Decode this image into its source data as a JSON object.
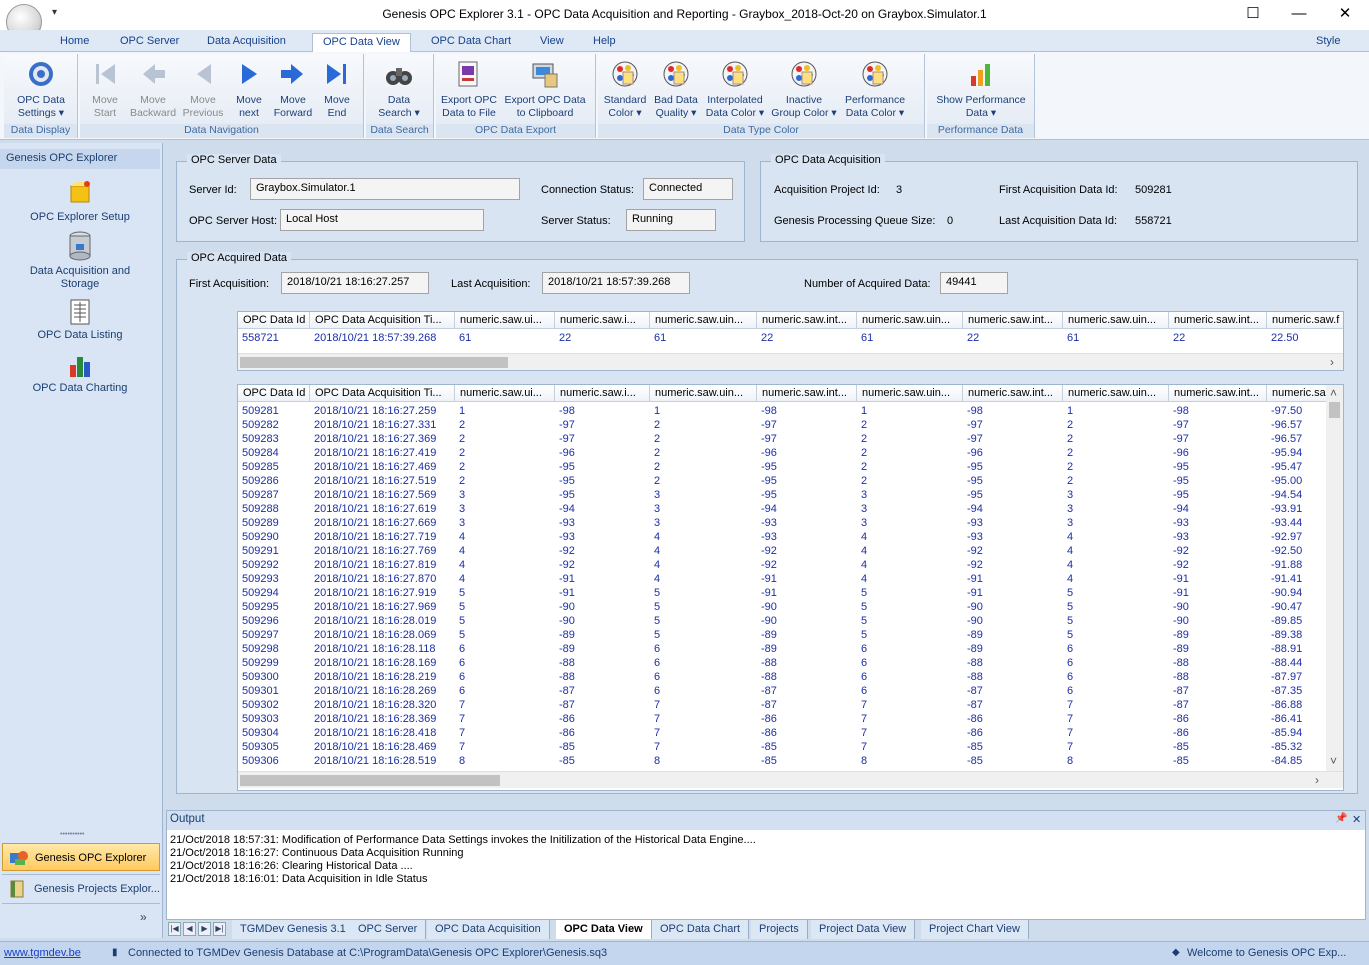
{
  "window": {
    "title": "Genesis OPC Explorer 3.1 - OPC Data Acquisition and Reporting - Graybox_2018-Oct-20 on Graybox.Simulator.1",
    "qat": "▾",
    "minimize": "—",
    "maximize": "☐",
    "close": "✕"
  },
  "menu": {
    "tabs": [
      "Home",
      "OPC Server",
      "Data Acquisition",
      "OPC Data View",
      "OPC Data Chart",
      "View",
      "Help"
    ],
    "active": "OPC Data View",
    "style": "Style"
  },
  "ribbon": {
    "groups": [
      {
        "label": "Data Display",
        "buttons": [
          {
            "l1": "OPC Data",
            "l2": "Settings ▾",
            "icon": "gear-icon"
          }
        ]
      },
      {
        "label": "Data Navigation",
        "buttons": [
          {
            "l1": "Move",
            "l2": "Start",
            "icon": "move-start-icon",
            "enabled": false
          },
          {
            "l1": "Move",
            "l2": "Backward",
            "icon": "move-backward-icon",
            "enabled": false
          },
          {
            "l1": "Move",
            "l2": "Previous",
            "icon": "move-previous-icon",
            "enabled": false
          },
          {
            "l1": "Move",
            "l2": "next",
            "icon": "move-next-icon",
            "enabled": true
          },
          {
            "l1": "Move",
            "l2": "Forward",
            "icon": "move-forward-icon",
            "enabled": true
          },
          {
            "l1": "Move",
            "l2": "End",
            "icon": "move-end-icon",
            "enabled": true
          }
        ]
      },
      {
        "label": "Data Search",
        "buttons": [
          {
            "l1": "Data",
            "l2": "Search ▾",
            "icon": "binoculars-icon"
          }
        ]
      },
      {
        "label": "OPC Data Export",
        "buttons": [
          {
            "l1": "Export OPC",
            "l2": "Data to File",
            "icon": "export-file-icon"
          },
          {
            "l1": "Export OPC Data",
            "l2": "to Clipboard",
            "icon": "export-clipboard-icon"
          }
        ]
      },
      {
        "label": "Data Type Color",
        "buttons": [
          {
            "l1": "Standard",
            "l2": "Color ▾",
            "icon": "palette-icon"
          },
          {
            "l1": "Bad Data",
            "l2": "Quality ▾",
            "icon": "palette-icon"
          },
          {
            "l1": "Interpolated",
            "l2": "Data Color ▾",
            "icon": "palette-icon"
          },
          {
            "l1": "Inactive",
            "l2": "Group Color ▾",
            "icon": "palette-icon"
          },
          {
            "l1": "Performance",
            "l2": "Data Color ▾",
            "icon": "palette-icon"
          }
        ]
      },
      {
        "label": "Performance Data",
        "buttons": [
          {
            "l1": "Show Performance",
            "l2": "Data ▾",
            "icon": "bar-chart-icon"
          }
        ]
      }
    ]
  },
  "leftpane": {
    "header": "Genesis OPC Explorer",
    "items": [
      {
        "label": "OPC Explorer Setup",
        "icon": "setup-icon"
      },
      {
        "label": "Data Acquisition and Storage",
        "icon": "database-icon"
      },
      {
        "label": "OPC Data Listing",
        "icon": "listing-icon"
      },
      {
        "label": "OPC Data Charting",
        "icon": "charting-icon"
      }
    ],
    "grip": "••••••••••",
    "tabs": [
      "Genesis OPC Explorer",
      "Genesis Projects Explor..."
    ],
    "more": "»"
  },
  "server": {
    "title": "OPC Server Data",
    "id_label": "Server Id:",
    "id": "Graybox.Simulator.1",
    "host_label": "OPC Server Host:",
    "host": "Local Host",
    "conn_label": "Connection Status:",
    "conn": "Connected",
    "status_label": "Server Status:",
    "status": "Running"
  },
  "acq": {
    "title": "OPC Data Acquisition",
    "project_label": "Acquisition Project Id:",
    "project": "3",
    "queue_label": "Genesis Processing Queue Size:",
    "queue": "0",
    "first_label": "First Acquisition Data Id:",
    "first": "509281",
    "last_label": "Last Acquisition Data Id:",
    "last": "558721"
  },
  "acquired": {
    "title": "OPC Acquired Data",
    "first_label": "First Acquisition:",
    "first": "2018/10/21 18:16:27.257",
    "last_label": "Last Acquisition:",
    "last": "2018/10/21 18:57:39.268",
    "count_label": "Number of Acquired Data:",
    "count": "49441"
  },
  "grid_columns": [
    "OPC Data Id",
    "OPC Data Acquisition Ti...",
    "numeric.saw.ui...",
    "numeric.saw.i...",
    "numeric.saw.uin...",
    "numeric.saw.int...",
    "numeric.saw.uin...",
    "numeric.saw.int...",
    "numeric.saw.uin...",
    "numeric.saw.int...",
    "numeric.saw.f"
  ],
  "grid_columns2": [
    "OPC Data Id",
    "OPC Data Acquisition Ti...",
    "numeric.saw.ui...",
    "numeric.saw.i...",
    "numeric.saw.uin...",
    "numeric.saw.int...",
    "numeric.saw.uin...",
    "numeric.saw.int...",
    "numeric.saw.uin...",
    "numeric.saw.int...",
    "numeric.sa"
  ],
  "latest_row": [
    "558721",
    "2018/10/21 18:57:39.268",
    "61",
    "22",
    "61",
    "22",
    "61",
    "22",
    "61",
    "22",
    "22.50"
  ],
  "rows": [
    [
      "509281",
      "2018/10/21 18:16:27.259",
      "1",
      "-98",
      "1",
      "-98",
      "1",
      "-98",
      "1",
      "-98",
      "-97.50"
    ],
    [
      "509282",
      "2018/10/21 18:16:27.331",
      "2",
      "-97",
      "2",
      "-97",
      "2",
      "-97",
      "2",
      "-97",
      "-96.57"
    ],
    [
      "509283",
      "2018/10/21 18:16:27.369",
      "2",
      "-97",
      "2",
      "-97",
      "2",
      "-97",
      "2",
      "-97",
      "-96.57"
    ],
    [
      "509284",
      "2018/10/21 18:16:27.419",
      "2",
      "-96",
      "2",
      "-96",
      "2",
      "-96",
      "2",
      "-96",
      "-95.94"
    ],
    [
      "509285",
      "2018/10/21 18:16:27.469",
      "2",
      "-95",
      "2",
      "-95",
      "2",
      "-95",
      "2",
      "-95",
      "-95.47"
    ],
    [
      "509286",
      "2018/10/21 18:16:27.519",
      "2",
      "-95",
      "2",
      "-95",
      "2",
      "-95",
      "2",
      "-95",
      "-95.00"
    ],
    [
      "509287",
      "2018/10/21 18:16:27.569",
      "3",
      "-95",
      "3",
      "-95",
      "3",
      "-95",
      "3",
      "-95",
      "-94.54"
    ],
    [
      "509288",
      "2018/10/21 18:16:27.619",
      "3",
      "-94",
      "3",
      "-94",
      "3",
      "-94",
      "3",
      "-94",
      "-93.91"
    ],
    [
      "509289",
      "2018/10/21 18:16:27.669",
      "3",
      "-93",
      "3",
      "-93",
      "3",
      "-93",
      "3",
      "-93",
      "-93.44"
    ],
    [
      "509290",
      "2018/10/21 18:16:27.719",
      "4",
      "-93",
      "4",
      "-93",
      "4",
      "-93",
      "4",
      "-93",
      "-92.97"
    ],
    [
      "509291",
      "2018/10/21 18:16:27.769",
      "4",
      "-92",
      "4",
      "-92",
      "4",
      "-92",
      "4",
      "-92",
      "-92.50"
    ],
    [
      "509292",
      "2018/10/21 18:16:27.819",
      "4",
      "-92",
      "4",
      "-92",
      "4",
      "-92",
      "4",
      "-92",
      "-91.88"
    ],
    [
      "509293",
      "2018/10/21 18:16:27.870",
      "4",
      "-91",
      "4",
      "-91",
      "4",
      "-91",
      "4",
      "-91",
      "-91.41"
    ],
    [
      "509294",
      "2018/10/21 18:16:27.919",
      "5",
      "-91",
      "5",
      "-91",
      "5",
      "-91",
      "5",
      "-91",
      "-90.94"
    ],
    [
      "509295",
      "2018/10/21 18:16:27.969",
      "5",
      "-90",
      "5",
      "-90",
      "5",
      "-90",
      "5",
      "-90",
      "-90.47"
    ],
    [
      "509296",
      "2018/10/21 18:16:28.019",
      "5",
      "-90",
      "5",
      "-90",
      "5",
      "-90",
      "5",
      "-90",
      "-89.85"
    ],
    [
      "509297",
      "2018/10/21 18:16:28.069",
      "5",
      "-89",
      "5",
      "-89",
      "5",
      "-89",
      "5",
      "-89",
      "-89.38"
    ],
    [
      "509298",
      "2018/10/21 18:16:28.118",
      "6",
      "-89",
      "6",
      "-89",
      "6",
      "-89",
      "6",
      "-89",
      "-88.91"
    ],
    [
      "509299",
      "2018/10/21 18:16:28.169",
      "6",
      "-88",
      "6",
      "-88",
      "6",
      "-88",
      "6",
      "-88",
      "-88.44"
    ],
    [
      "509300",
      "2018/10/21 18:16:28.219",
      "6",
      "-88",
      "6",
      "-88",
      "6",
      "-88",
      "6",
      "-88",
      "-87.97"
    ],
    [
      "509301",
      "2018/10/21 18:16:28.269",
      "6",
      "-87",
      "6",
      "-87",
      "6",
      "-87",
      "6",
      "-87",
      "-87.35"
    ],
    [
      "509302",
      "2018/10/21 18:16:28.320",
      "7",
      "-87",
      "7",
      "-87",
      "7",
      "-87",
      "7",
      "-87",
      "-86.88"
    ],
    [
      "509303",
      "2018/10/21 18:16:28.369",
      "7",
      "-86",
      "7",
      "-86",
      "7",
      "-86",
      "7",
      "-86",
      "-86.41"
    ],
    [
      "509304",
      "2018/10/21 18:16:28.418",
      "7",
      "-86",
      "7",
      "-86",
      "7",
      "-86",
      "7",
      "-86",
      "-85.94"
    ],
    [
      "509305",
      "2018/10/21 18:16:28.469",
      "7",
      "-85",
      "7",
      "-85",
      "7",
      "-85",
      "7",
      "-85",
      "-85.32"
    ],
    [
      "509306",
      "2018/10/21 18:16:28.519",
      "8",
      "-85",
      "8",
      "-85",
      "8",
      "-85",
      "8",
      "-85",
      "-84.85"
    ]
  ],
  "output": {
    "title": "Output",
    "pin": "📌",
    "close": "✕",
    "lines": [
      "21/Oct/2018 18:57:31: Modification of Performance Data Settings invokes the Initilization of the Historical Data Engine....",
      "21/Oct/2018 18:16:27: Continuous Data Acquisition Running",
      "21/Oct/2018 18:16:26: Clearing Historical Data ....",
      "21/Oct/2018 18:16:01: Data Acquisition in Idle Status"
    ]
  },
  "doctabs": [
    "TGMDev Genesis 3.1",
    "OPC Server",
    "OPC Data Acquisition",
    "OPC Data View",
    "OPC Data Chart",
    "Projects",
    "Project Data View",
    "Project Chart View"
  ],
  "doctab_active": "OPC Data View",
  "status": {
    "link": "www.tgmdev.be",
    "db": "Connected to TGMDev Genesis Database at C:\\ProgramData\\Genesis OPC Explorer\\Genesis.sq3",
    "welcome": "Welcome to Genesis OPC Exp..."
  }
}
